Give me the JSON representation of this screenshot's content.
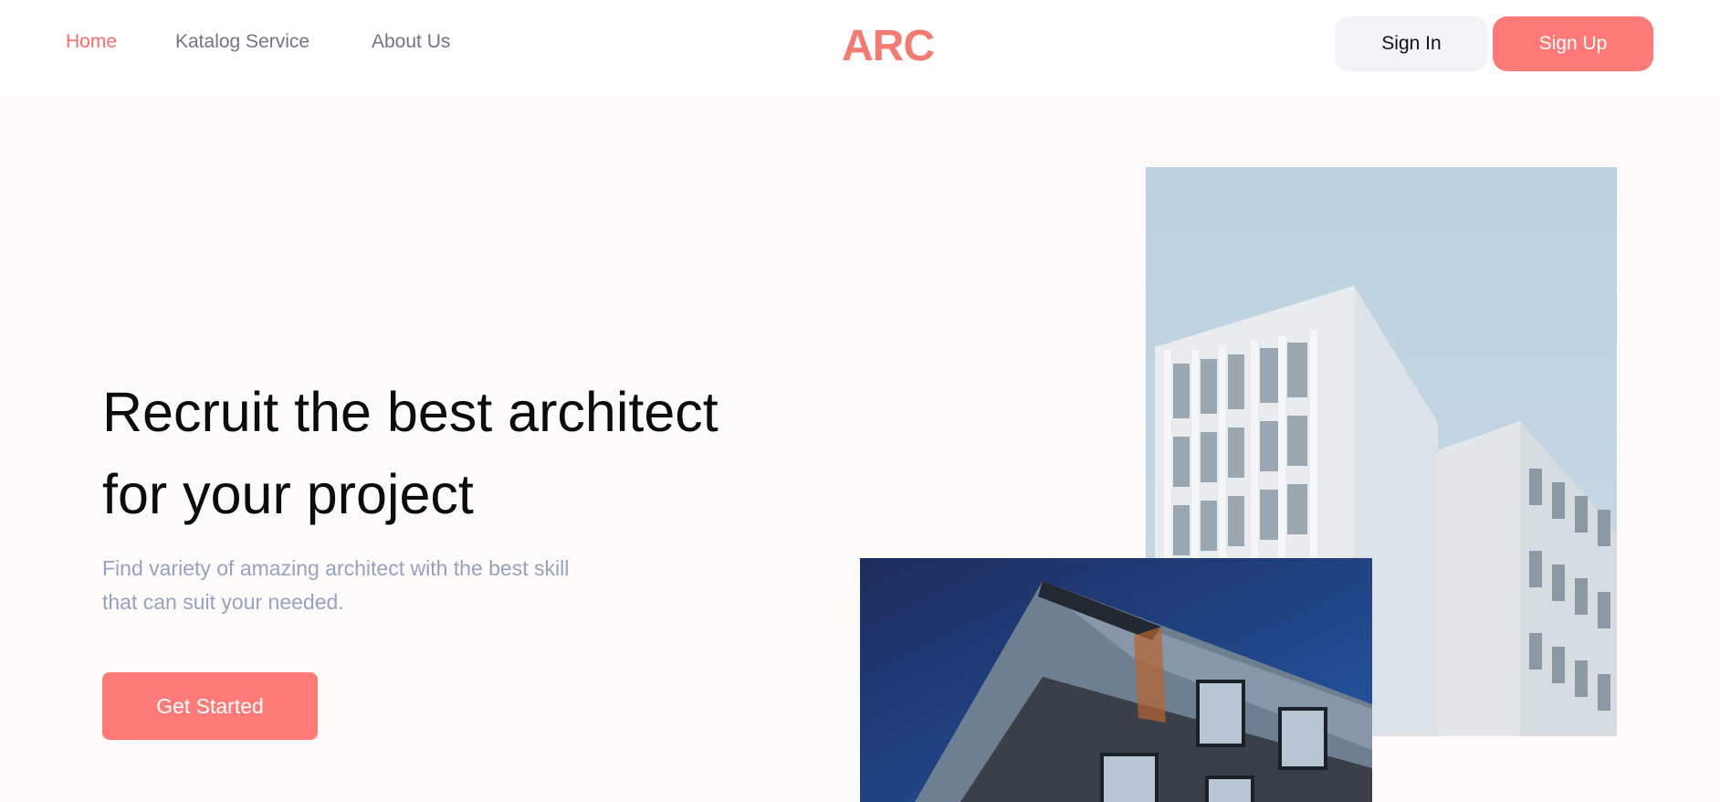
{
  "nav": {
    "links": [
      {
        "label": "Home",
        "active": true
      },
      {
        "label": "Katalog Service",
        "active": false
      },
      {
        "label": "About Us",
        "active": false
      }
    ],
    "logo_text": "ARC",
    "signin_label": "Sign In",
    "signup_label": "Sign Up"
  },
  "hero": {
    "title_line1": "Recruit the best architect",
    "title_line2": "for your project",
    "subtitle_line1": "Find variety of amazing architect with the best skill",
    "subtitle_line2": "that can suit your needed.",
    "cta_label": "Get Started"
  },
  "colors": {
    "accent": "#fd7a78",
    "active_nav": "#ff6b6b",
    "nav_text": "#717585",
    "subtitle": "#97a2bf",
    "page_bg": "#fcfbfa"
  },
  "images": [
    {
      "name": "white-apartment-building-photo"
    },
    {
      "name": "brick-building-corner-photo"
    }
  ]
}
